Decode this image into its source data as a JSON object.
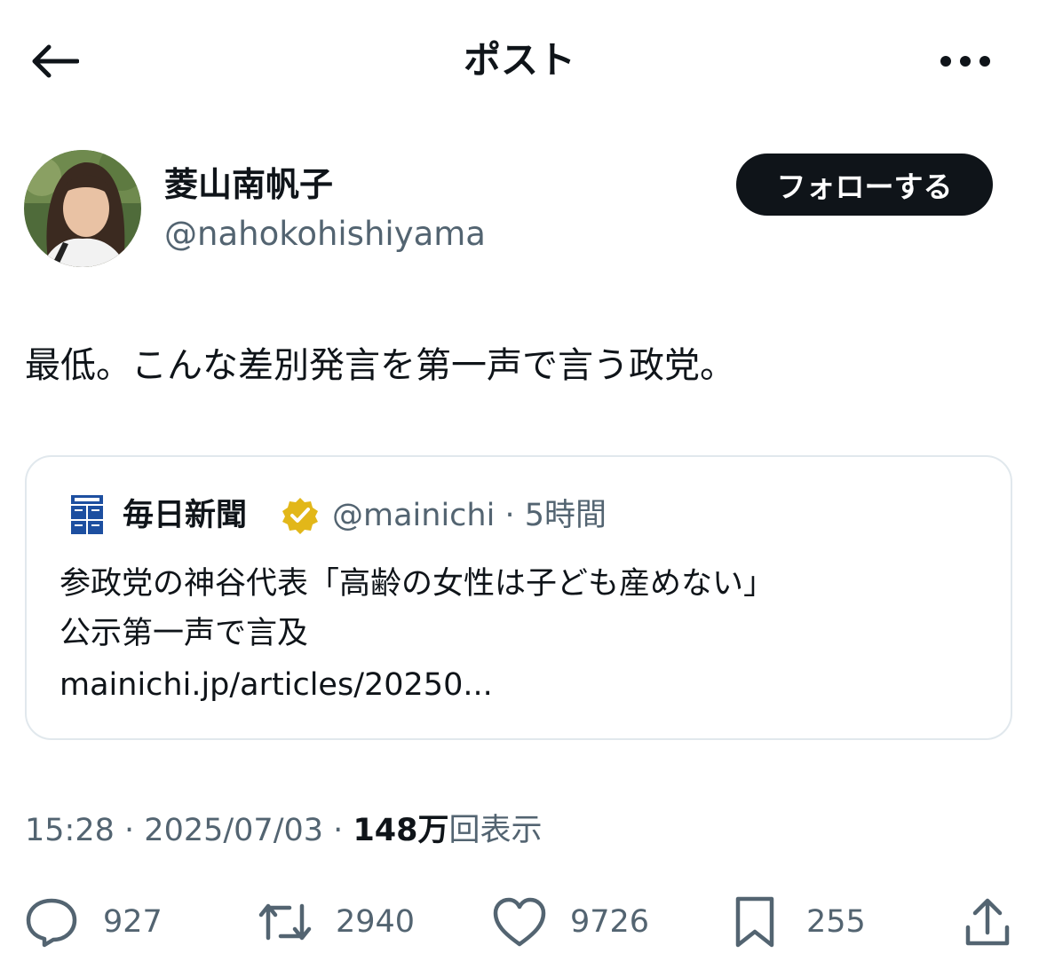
{
  "header": {
    "title": "ポスト",
    "back_icon": "arrow-left-icon",
    "more_icon": "more-horizontal-icon"
  },
  "author": {
    "name": "菱山南帆子",
    "handle": "@nahokohishiyama",
    "follow_label": "フォローする"
  },
  "post": {
    "text": "最低。こんな差別発言を第一声で言う政党。"
  },
  "quote": {
    "name": "毎日新聞",
    "handle": "@mainichi",
    "separator": "·",
    "time": "5時間",
    "line1": "参政党の神谷代表「高齢の女性は子ども産めない」",
    "line2": "公示第一声で言及",
    "link": "mainichi.jp/articles/20250..."
  },
  "meta": {
    "time": "15:28",
    "sep1": "·",
    "date": "2025/07/03",
    "sep2": "·",
    "views_count": "148万",
    "views_label": "回表示"
  },
  "actions": {
    "replies": "927",
    "reposts": "2940",
    "likes": "9726",
    "bookmarks": "255"
  },
  "colors": {
    "text": "#0f1419",
    "secondary": "#536471",
    "border": "#e1e8ed",
    "verified_gold": "#e2b719"
  }
}
